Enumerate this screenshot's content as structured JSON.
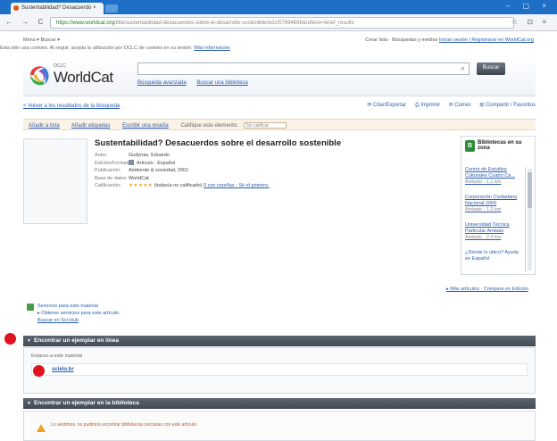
{
  "browser": {
    "tab_title": "Sustentabilidad? Desacuerdo ×",
    "tab_close": "×",
    "window_controls": "– ▢ ×",
    "nav_buttons": "← → C ⌂",
    "url_host": "https://www.worldcat.org",
    "url_rest": "/title/sustentabilidad-desacuerdos-sobre-el-desarrollo-sostenible/oclc/57694698&referer=brief_results",
    "chrome_icons": "☆ ⊡ ≡"
  },
  "topstrip": {
    "menu": "Menú ▾   Buscar ▾",
    "notice": "Esta sitio usa cookies. Al seguir, acepta la utilización por OCLC de cookies en su sesión.",
    "notice_link": "Más información",
    "right_text": "Crear lista · Búsquedas y medios",
    "right_link": "Iniciar sesión | Registrarse en WorldCat.org"
  },
  "header": {
    "logo_small": "OCLC",
    "logo_text": "WorldCat",
    "search_value": "",
    "search_button": "Buscar",
    "link_advanced": "Búsqueda avanzada",
    "link_find_library": "Buscar una biblioteca"
  },
  "results": {
    "back_link": "< Volver a los resultados de la búsqueda",
    "share_items": [
      "✉ Citar/Exportar",
      "⎙ Imprimir",
      "✉ Correo",
      "⊞ Compartir / Favoritos"
    ]
  },
  "toolbar": {
    "items": [
      "Añadir a lista",
      "Añadir etiquetas",
      "Escribir una reseña"
    ],
    "tag_label": "Califique este elemento:",
    "tag_placeholder": "Sin calificar"
  },
  "book": {
    "title": "Sustentabilidad? Desacuerdos sobre el desarrollo sostenible",
    "fields": [
      {
        "label": "Autor:",
        "value": "Gudynas, Eduardo"
      },
      {
        "label": "Edición/Formato:",
        "value": "Artículo : Español"
      },
      {
        "label": "Publicación:",
        "value": "Ambiente & sociedad, 2001"
      },
      {
        "label": "Base de datos:",
        "value": "WorldCat"
      },
      {
        "label": "Calificación:",
        "value": "(todavía no calificado)",
        "stars": "★★★★★",
        "link": "0 con reseñas - Sé el primero."
      }
    ]
  },
  "library": {
    "icon_letter": "B",
    "heading": "Bibliotecas en su zona",
    "items": [
      {
        "name": "Centro de Estudios Culturales Cuatro Ca...",
        "sub": "Ambato · 1.1 km"
      },
      {
        "name": "Corporación Ciudadana Nacional 2000",
        "sub": "Ambato · 1.2 km"
      },
      {
        "name": "Universidad Técnica Particular Ambato",
        "sub": "Ambato · 2.4 km"
      }
    ],
    "more": "¿Dónde lo ubico? Ayuda en Español",
    "footer": "▸ Más artículos · Compare en Edición"
  },
  "services": {
    "line1": "Servicios para este material",
    "line2": "▸ Obtener servicios para este artículo",
    "line3": "Buscar en Sci-Hub"
  },
  "sections": {
    "online_title": "Encontrar un ejemplar en línea",
    "online_label": "Enlaces a este material",
    "online_link": "scielo.br",
    "library_title": "Encontrar un ejemplar en la biblioteca",
    "warning": "Lo sentimos, no pudimos encontrar bibliotecas cercanas con este artículo."
  },
  "colors": {
    "chrome_blue": "#1f6fc6",
    "link_blue": "#2a5db0",
    "section_bar": "#4b525d",
    "marker_red": "#e0121f"
  }
}
